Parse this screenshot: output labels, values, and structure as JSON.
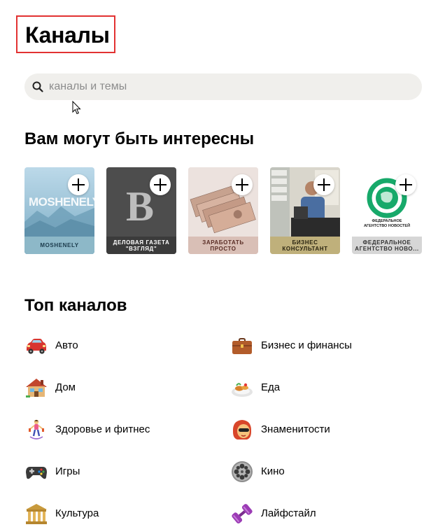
{
  "page": {
    "title": "Каналы"
  },
  "search": {
    "placeholder": "каналы и темы"
  },
  "recommendations": {
    "heading": "Вам могут быть интересны",
    "cards": [
      {
        "label": "MOSHENELY",
        "art_text": "MOSHENELY"
      },
      {
        "label": "ДЕЛОВАЯ ГАЗЕТА \"ВЗГЛЯД\"",
        "art_text": "B"
      },
      {
        "label": "ЗАРАБОТАТЬ ПРОСТО"
      },
      {
        "label": "БИЗНЕС КОНСУЛЬТАНТ"
      },
      {
        "label": "ФЕДЕРАЛЬНОЕ АГЕНТСТВО НОВО...",
        "art_text": "ФЕДЕРАЛЬНОЕ АГЕНТСТВО НОВОСТЕЙ"
      }
    ]
  },
  "top_channels": {
    "heading": "Топ каналов",
    "categories": [
      {
        "label": "Авто",
        "icon": "car-icon"
      },
      {
        "label": "Бизнес и финансы",
        "icon": "briefcase-icon"
      },
      {
        "label": "Дом",
        "icon": "house-icon"
      },
      {
        "label": "Еда",
        "icon": "food-plate-icon"
      },
      {
        "label": "Здоровье и фитнес",
        "icon": "jump-rope-icon"
      },
      {
        "label": "Знаменитости",
        "icon": "celebrity-face-icon"
      },
      {
        "label": "Игры",
        "icon": "gamepad-icon"
      },
      {
        "label": "Кино",
        "icon": "film-reel-icon"
      },
      {
        "label": "Культура",
        "icon": "museum-icon"
      },
      {
        "label": "Лайфстайл",
        "icon": "dumbbell-icon"
      }
    ]
  }
}
